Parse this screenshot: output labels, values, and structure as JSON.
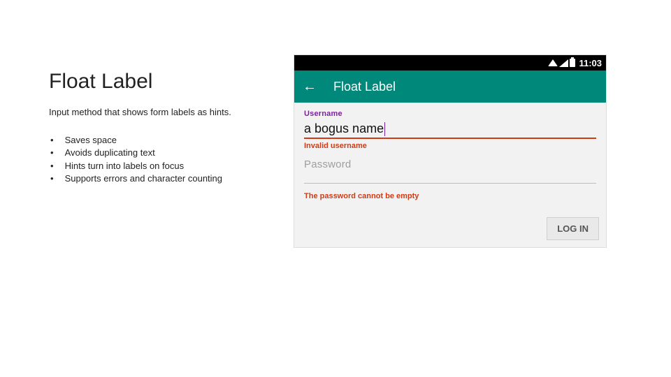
{
  "slide": {
    "title": "Float Label",
    "subtitle": "Input method that shows form labels as hints.",
    "bullets": [
      "Saves space",
      "Avoids duplicating text",
      "Hints turn into labels on focus",
      "Supports errors and character counting"
    ]
  },
  "statusbar": {
    "time": "11:03"
  },
  "appbar": {
    "title": "Float Label"
  },
  "form": {
    "username": {
      "label": "Username",
      "value": "a bogus name",
      "error": "Invalid username"
    },
    "password": {
      "label": "Password",
      "value": "",
      "error": "The password cannot be empty"
    },
    "login_label": "LOG IN"
  }
}
